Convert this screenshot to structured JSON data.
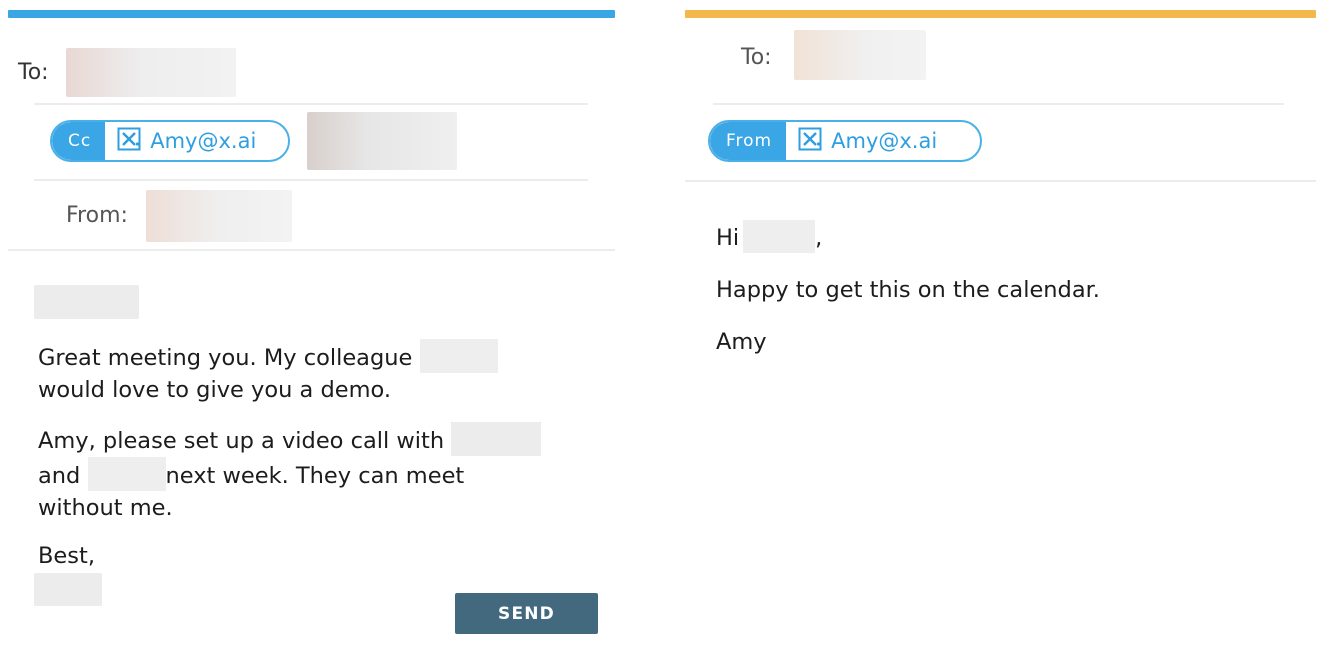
{
  "left_panel": {
    "accent_color": "#3aa6e6",
    "to_label": "To:",
    "cc_tag": "Cc",
    "cc_email": "Amy@x.ai",
    "from_label": "From:",
    "body": {
      "line1_a": "Great meeting you. My colleague",
      "line1_b": "would love to give you a demo.",
      "line2_a": "Amy, please set up a video call with",
      "line2_b_pre": "and",
      "line2_b_post": "next week. They can meet",
      "line2_c": "without me.",
      "signoff": "Best,"
    },
    "send_label": "SEND",
    "send_color": "#43697f"
  },
  "right_panel": {
    "accent_color": "#f2b84b",
    "to_label": "To:",
    "from_tag": "From",
    "from_email": "Amy@x.ai",
    "body": {
      "greeting_pre": "Hi",
      "greeting_post": ",",
      "line1": "Happy to get this on the calendar.",
      "signature": "Amy"
    }
  },
  "icons": {
    "assistant_logo": "x-ai-logo-icon"
  }
}
